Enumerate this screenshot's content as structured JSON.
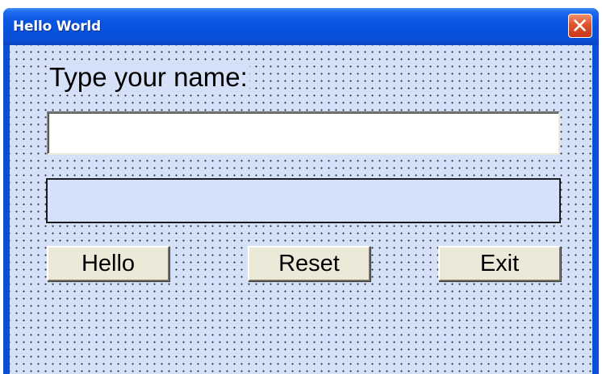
{
  "window": {
    "title": "Hello World"
  },
  "form": {
    "name_label": "Type your name:",
    "name_input_value": "",
    "output_text": ""
  },
  "buttons": {
    "hello_label": "Hello",
    "reset_label": "Reset",
    "exit_label": "Exit"
  },
  "icons": {
    "close": "close-icon"
  },
  "colors": {
    "titlebar": "#0a56e3",
    "client_background": "#d5e1f8",
    "button_face": "#ece9d8",
    "close_button": "#e0542c"
  }
}
